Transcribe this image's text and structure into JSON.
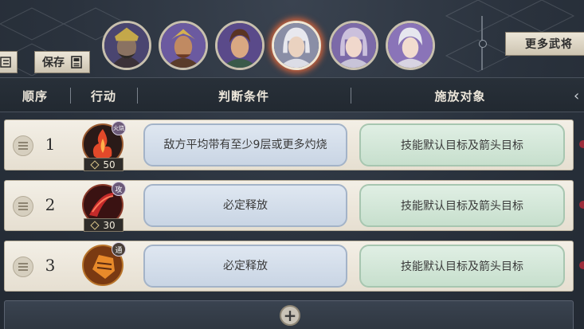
{
  "toolbar": {
    "save_label": "保存",
    "more_label": "更多武将"
  },
  "avatars": [
    {
      "name": "general-1",
      "selected": false
    },
    {
      "name": "general-2",
      "selected": false
    },
    {
      "name": "general-3",
      "selected": false
    },
    {
      "name": "general-4",
      "selected": true
    },
    {
      "name": "general-5",
      "selected": false
    },
    {
      "name": "general-6",
      "selected": false
    }
  ],
  "table": {
    "headers": {
      "order": "顺序",
      "action": "行动",
      "condition": "判断条件",
      "target": "施放对象"
    },
    "rows": [
      {
        "order": "1",
        "cost": "50",
        "tag": "火烧",
        "condition": "敌方平均带有至少9层或更多灼烧",
        "target": "技能默认目标及箭头目标"
      },
      {
        "order": "2",
        "cost": "30",
        "tag": "攻",
        "condition": "必定释放",
        "target": "技能默认目标及箭头目标"
      },
      {
        "order": "3",
        "cost": "",
        "tag": "通",
        "condition": "必定释放",
        "target": "技能默认目标及箭头目标"
      }
    ]
  },
  "add_button": "+",
  "colors": {
    "selected_glow": "#d8643a",
    "condition_bg": "#c9d5e4",
    "target_bg": "#c7dfcd"
  }
}
